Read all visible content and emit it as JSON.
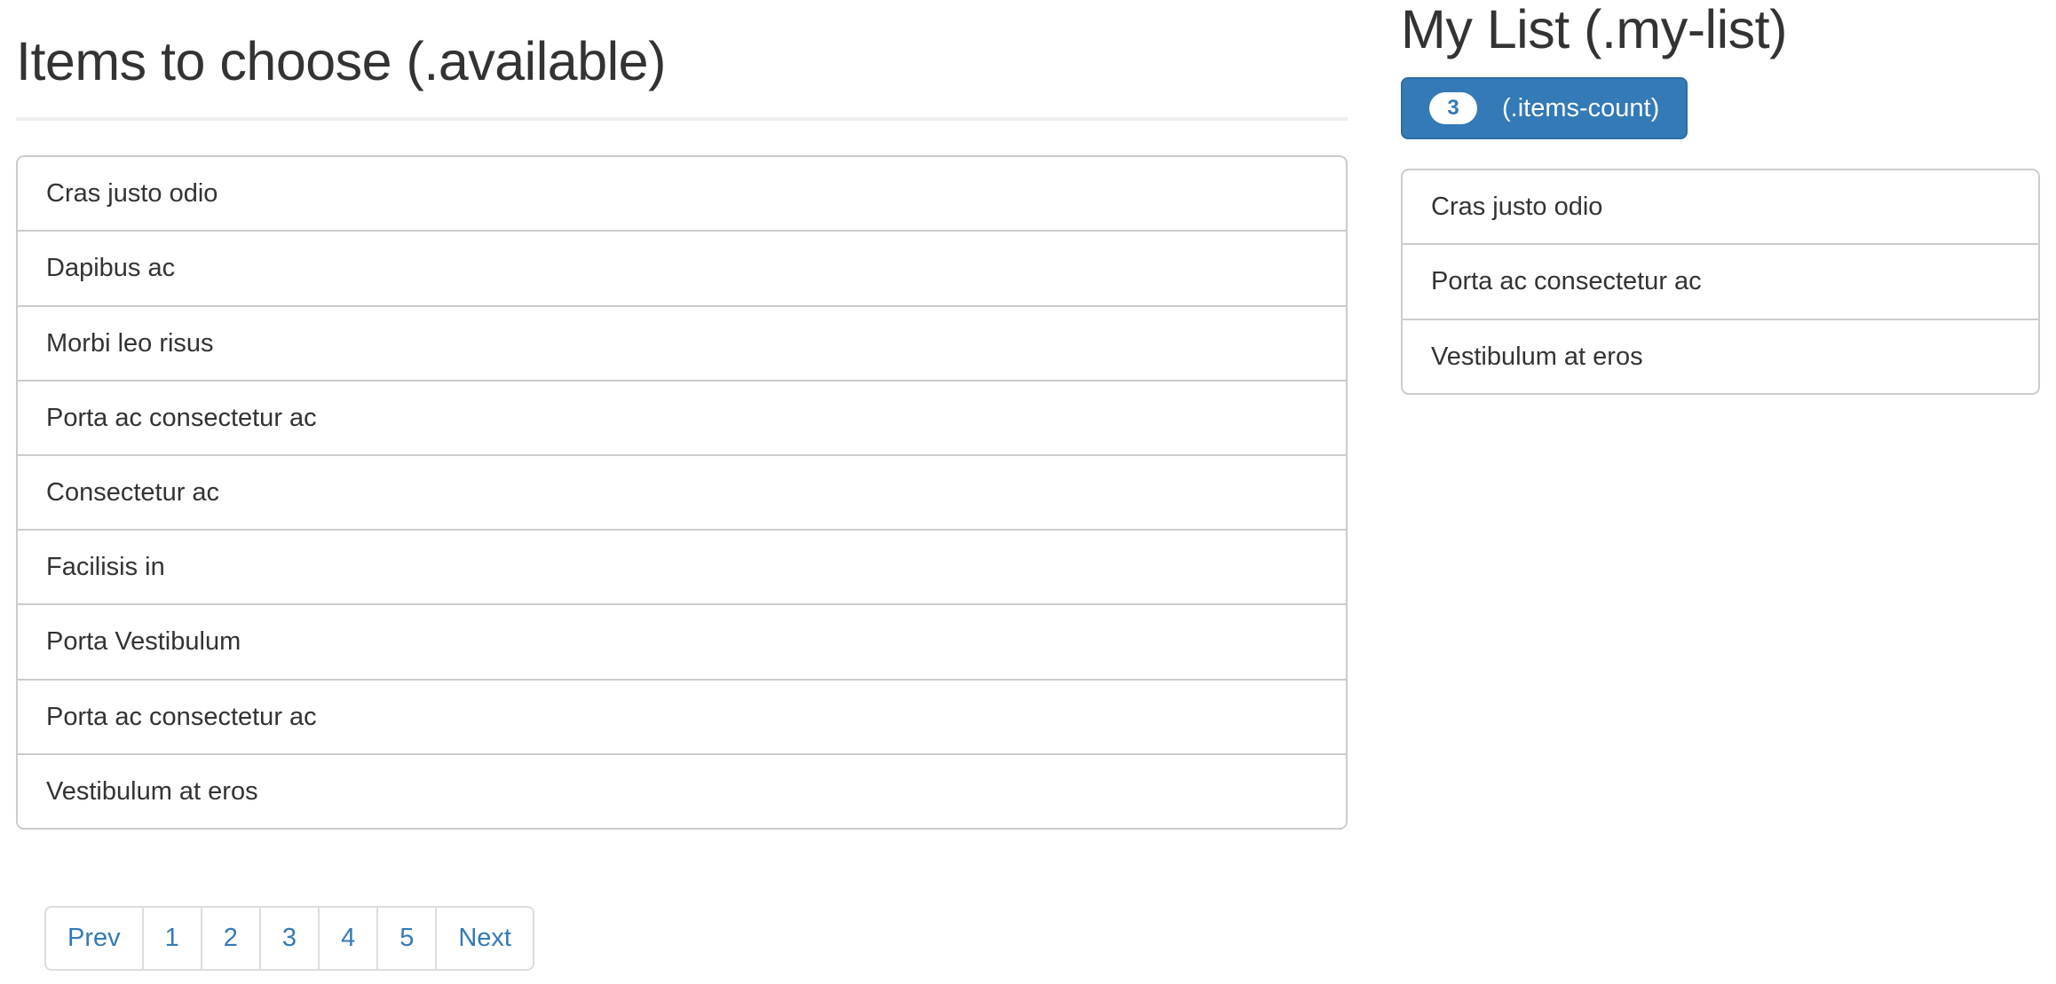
{
  "colors": {
    "primary": "#337ab7",
    "primary_border": "#2e6da4",
    "list_border": "#cccccc",
    "rule": "#eeeeee",
    "pagination_border": "#dddddd",
    "link": "#337ab7",
    "text": "#333333",
    "badge_bg": "#ffffff"
  },
  "available_panel": {
    "heading": "Items to choose (.available)",
    "items": [
      "Cras justo odio",
      "Dapibus ac",
      "Morbi leo risus",
      "Porta ac consectetur ac",
      "Consectetur ac",
      "Facilisis in",
      "Porta Vestibulum",
      "Porta ac consectetur ac",
      "Vestibulum at eros"
    ],
    "pagination": {
      "prev_label": "Prev",
      "pages": [
        "1",
        "2",
        "3",
        "4",
        "5"
      ],
      "next_label": "Next"
    }
  },
  "my_list_panel": {
    "heading": "My List (.my-list)",
    "count_button": {
      "badge": "3",
      "label": "(.items-count)"
    },
    "items": [
      "Cras justo odio",
      "Porta ac consectetur ac",
      "Vestibulum at eros"
    ]
  }
}
